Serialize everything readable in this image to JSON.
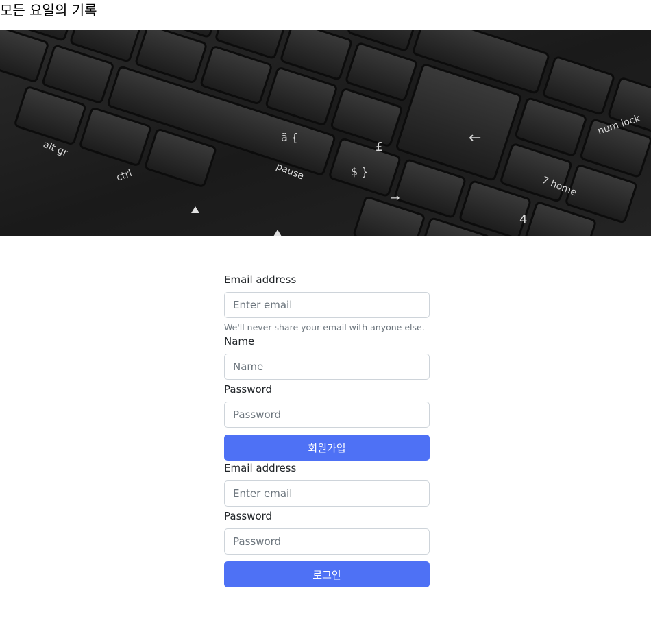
{
  "site": {
    "title": "모든 요일의 기록"
  },
  "hero": {
    "image_name": "laptop-keyboard-photo",
    "key_labels": [
      "alt gr",
      "ctrl",
      "pause",
      "num lock",
      "7 home",
      "4",
      "£",
      "$ }",
      "ä {",
      "←",
      "→"
    ]
  },
  "signup": {
    "email_label": "Email address",
    "email_placeholder": "Enter email",
    "email_help": "We'll never share your email with anyone else.",
    "name_label": "Name",
    "name_placeholder": "Name",
    "password_label": "Password",
    "password_placeholder": "Password",
    "submit_label": "회원가입"
  },
  "login": {
    "email_label": "Email address",
    "email_placeholder": "Enter email",
    "password_label": "Password",
    "password_placeholder": "Password",
    "submit_label": "로그인"
  },
  "colors": {
    "primary_button": "#4e71f5",
    "input_border": "#ced4da",
    "help_text": "#6c757d"
  }
}
